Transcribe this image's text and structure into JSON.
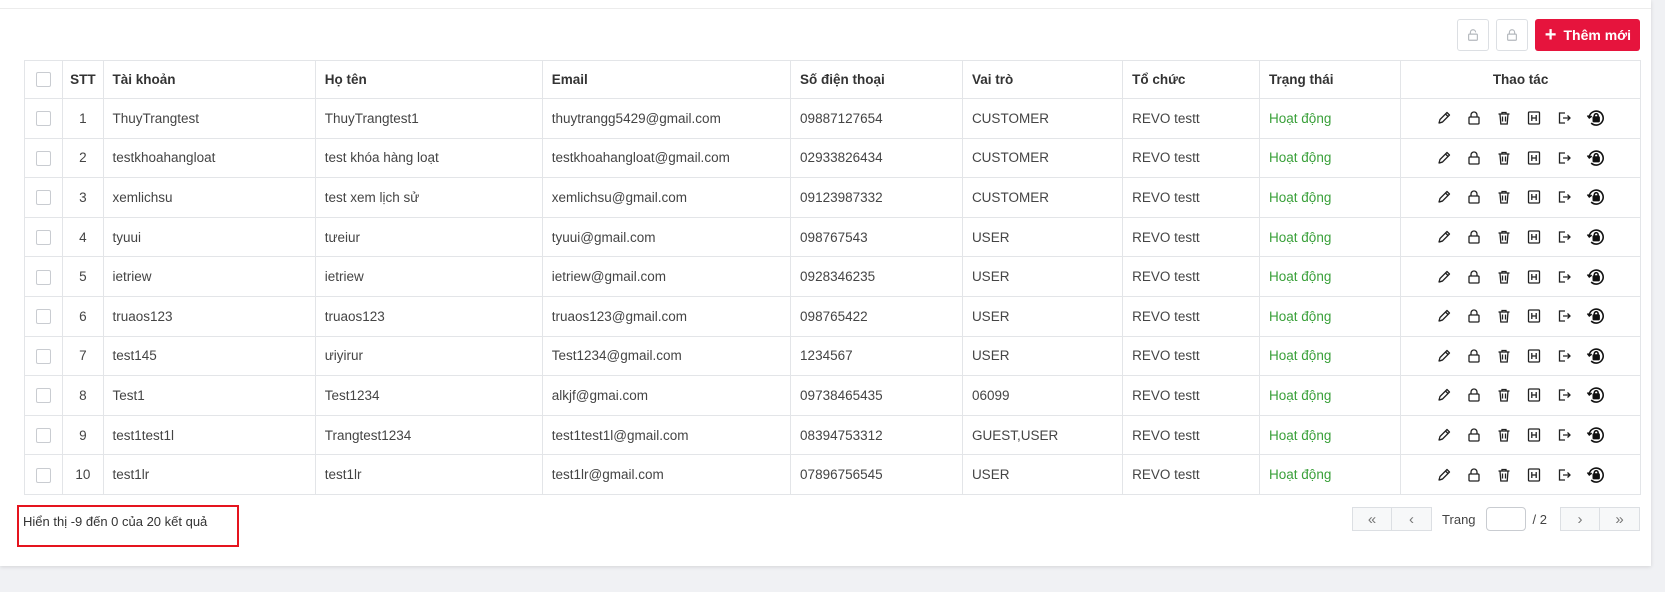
{
  "toolbar": {
    "add_label": "Thêm mới",
    "plus_symbol": "+",
    "accent_color": "#e6143d"
  },
  "table": {
    "headers": {
      "stt": "STT",
      "account": "Tài khoản",
      "fullname": "Họ tên",
      "email": "Email",
      "phone": "Số điện thoại",
      "role": "Vai trò",
      "org": "Tổ chức",
      "status": "Trạng thái",
      "actions": "Thao tác"
    },
    "rows": [
      {
        "stt": "1",
        "account": "ThuyTrangtest",
        "fullname": "ThuyTrangtest1",
        "email": "thuytrangg5429@gmail.com",
        "phone": "09887127654",
        "role": "CUSTOMER",
        "org": "REVO testt",
        "status": "Hoạt động"
      },
      {
        "stt": "2",
        "account": "testkhoahangloat",
        "fullname": "test khóa hàng loạt",
        "email": "testkhoahangloat@gmail.com",
        "phone": "02933826434",
        "role": "CUSTOMER",
        "org": "REVO testt",
        "status": "Hoạt động"
      },
      {
        "stt": "3",
        "account": "xemlichsu",
        "fullname": "test xem lịch sử",
        "email": "xemlichsu@gmail.com",
        "phone": "09123987332",
        "role": "CUSTOMER",
        "org": "REVO testt",
        "status": "Hoạt động"
      },
      {
        "stt": "4",
        "account": "tyuui",
        "fullname": "tưeiur",
        "email": "tyuui@gmail.com",
        "phone": "098767543",
        "role": "USER",
        "org": "REVO testt",
        "status": "Hoạt động"
      },
      {
        "stt": "5",
        "account": "ietriew",
        "fullname": "ietriew",
        "email": "ietriew@gmail.com",
        "phone": "0928346235",
        "role": "USER",
        "org": "REVO testt",
        "status": "Hoạt động"
      },
      {
        "stt": "6",
        "account": "truaos123",
        "fullname": "truaos123",
        "email": "truaos123@gmail.com",
        "phone": "098765422",
        "role": "USER",
        "org": "REVO testt",
        "status": "Hoạt động"
      },
      {
        "stt": "7",
        "account": "test145",
        "fullname": "ưiyirur",
        "email": "Test1234@gmail.com",
        "phone": "1234567",
        "role": "USER",
        "org": "REVO testt",
        "status": "Hoạt động"
      },
      {
        "stt": "8",
        "account": "Test1",
        "fullname": "Test1234",
        "email": "alkjf@gmai.com",
        "phone": "09738465435",
        "role": "06099",
        "org": "REVO testt",
        "status": "Hoạt động"
      },
      {
        "stt": "9",
        "account": "test1test1l",
        "fullname": "Trangtest1234",
        "email": "test1test1l@gmail.com",
        "phone": "08394753312",
        "role": "GUEST,USER",
        "org": "REVO testt",
        "status": "Hoạt động"
      },
      {
        "stt": "10",
        "account": "test1lr",
        "fullname": "test1lr",
        "email": "test1lr@gmail.com",
        "phone": "07896756545",
        "role": "USER",
        "org": "REVO testt",
        "status": "Hoạt động"
      }
    ],
    "status_color": "#3aa03a",
    "row_action_icons": [
      "pencil-icon",
      "lock-icon",
      "trash-icon",
      "h-box-icon",
      "export-icon",
      "lock-reset-icon"
    ]
  },
  "footer": {
    "summary": "Hiển thị -9 đến 0 của 20 kết quả",
    "page_label": "Trang",
    "page_value": "",
    "page_total": "/ 2",
    "first_symbol": "«",
    "prev_symbol": "‹",
    "next_symbol": "›",
    "last_symbol": "»",
    "highlight_color": "#e5141e"
  }
}
